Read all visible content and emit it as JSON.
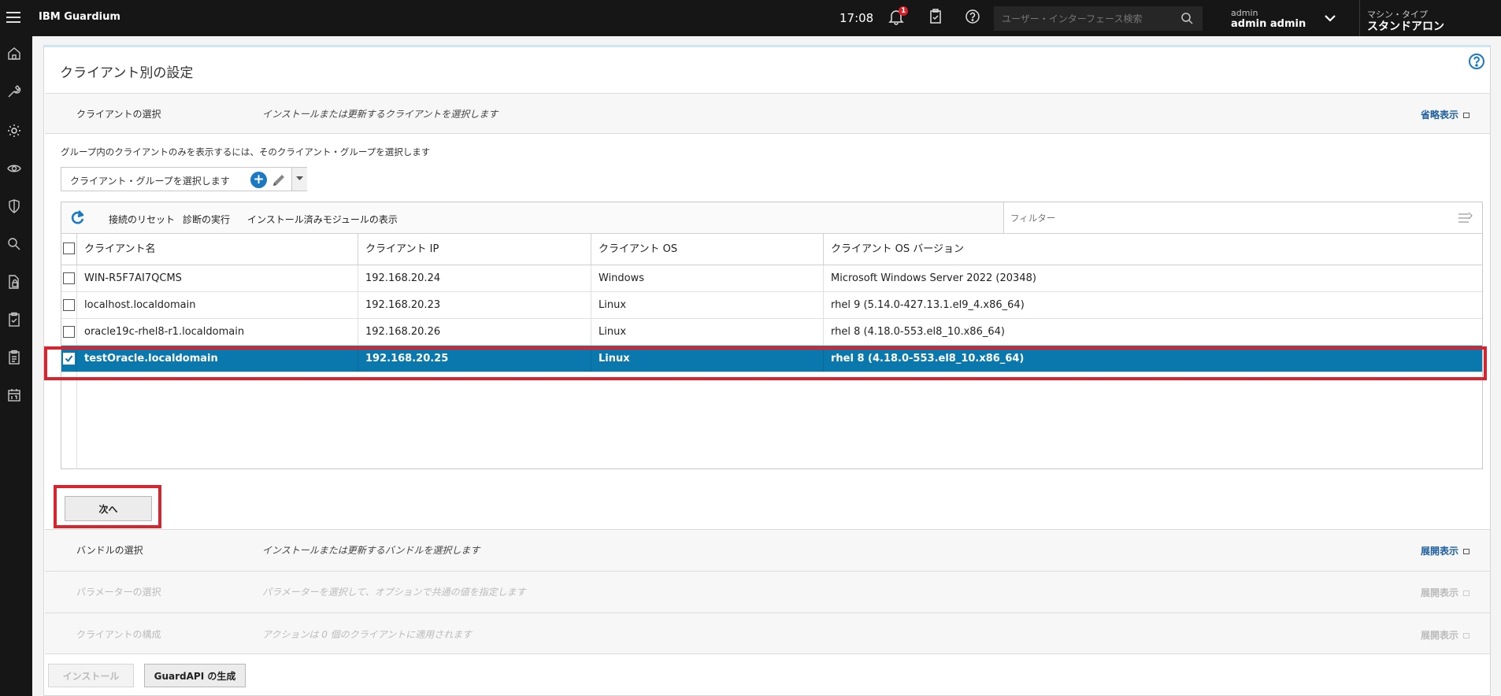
{
  "header": {
    "brand": "IBM Guardium",
    "time": "17:08",
    "notification_count": "1",
    "search_placeholder": "ユーザー・インターフェース検索",
    "user_role": "admin",
    "user_name": "admin admin",
    "machine_type_label": "マシン・タイプ",
    "machine_type_value": "スタンドアロン"
  },
  "page": {
    "title": "クライアント別の設定"
  },
  "sections": {
    "select_client": {
      "label": "クライアントの選択",
      "desc": "インストールまたは更新するクライアントを選択します",
      "toggle": "省略表示"
    },
    "select_bundle": {
      "label": "バンドルの選択",
      "desc": "インストールまたは更新するバンドルを選択します",
      "toggle": "展開表示"
    },
    "select_params": {
      "label": "パラメーターの選択",
      "desc": "パラメーターを選択して、オプションで共通の値を指定します",
      "toggle": "展開表示"
    },
    "client_config": {
      "label": "クライアントの構成",
      "desc": "アクションは 0 個のクライアントに適用されます",
      "toggle": "展開表示"
    }
  },
  "group": {
    "hint": "グループ内のクライアントのみを表示するには、そのクライアント・グループを選択します",
    "placeholder": "クライアント・グループを選択します",
    "add_symbol": "+"
  },
  "toolbar": {
    "reset": "接続のリセット",
    "diagnose": "診断の実行",
    "show_modules": "インストール済みモジュールの表示",
    "filter_placeholder": "フィルター"
  },
  "table": {
    "columns": [
      "クライアント名",
      "クライアント IP",
      "クライアント OS",
      "クライアント OS バージョン"
    ],
    "rows": [
      {
        "name": "WIN-R5F7AI7QCMS",
        "ip": "192.168.20.24",
        "os": "Windows",
        "version": "Microsoft Windows Server 2022 (20348)",
        "checked": false
      },
      {
        "name": "localhost.localdomain",
        "ip": "192.168.20.23",
        "os": "Linux",
        "version": "rhel 9 (5.14.0-427.13.1.el9_4.x86_64)",
        "checked": false
      },
      {
        "name": "oracle19c-rhel8-r1.localdomain",
        "ip": "192.168.20.26",
        "os": "Linux",
        "version": "rhel 8 (4.18.0-553.el8_10.x86_64)",
        "checked": false
      },
      {
        "name": "testOracle.localdomain",
        "ip": "192.168.20.25",
        "os": "Linux",
        "version": "rhel 8 (4.18.0-553.el8_10.x86_64)",
        "checked": true
      }
    ]
  },
  "buttons": {
    "next": "次へ",
    "install": "インストール",
    "guardapi": "GuardAPI の生成"
  },
  "colors": {
    "selected_row": "#0b78ad",
    "highlight": "#d9232e",
    "link": "#1d5e9e"
  }
}
